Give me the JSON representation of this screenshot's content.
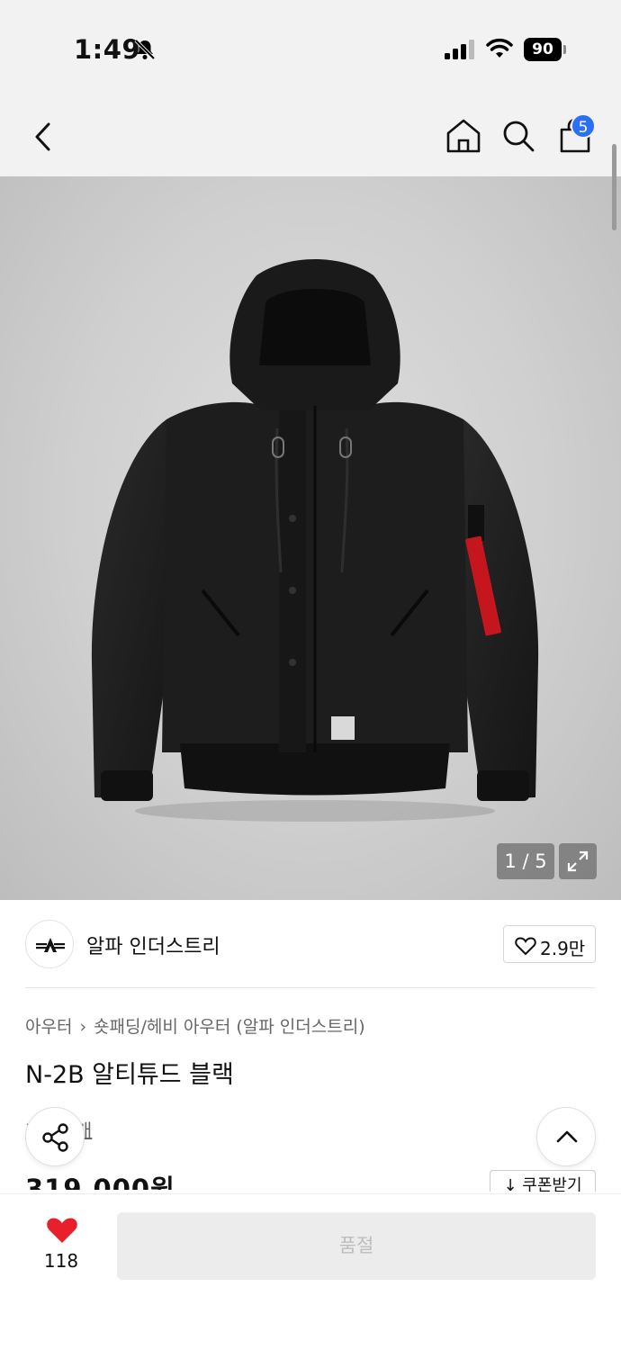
{
  "status_bar": {
    "time": "1:49",
    "battery": "90"
  },
  "header": {
    "cart_count": "5",
    "icons": [
      "back-icon",
      "home-icon",
      "search-icon",
      "cart-icon"
    ]
  },
  "gallery": {
    "counter": "1 / 5",
    "current_index": 1,
    "total": 5
  },
  "brand": {
    "name": "알파 인더스트리",
    "like_count": "2.9만"
  },
  "product": {
    "breadcrumb": [
      "아우터",
      "숏패딩/헤비 아우터 (알파 인더스트리)"
    ],
    "title": "N-2B 알티튜드 블랙",
    "review_link": "후기 1개",
    "price": "319,000원",
    "coupon_label": "↓ 쿠폰받기"
  },
  "bottom_bar": {
    "wish_count": "118",
    "primary_button": "품절"
  },
  "colors": {
    "accent_badge": "#2b6ff2",
    "heart_red": "#e8202b",
    "soldout_bg": "#ececec"
  }
}
